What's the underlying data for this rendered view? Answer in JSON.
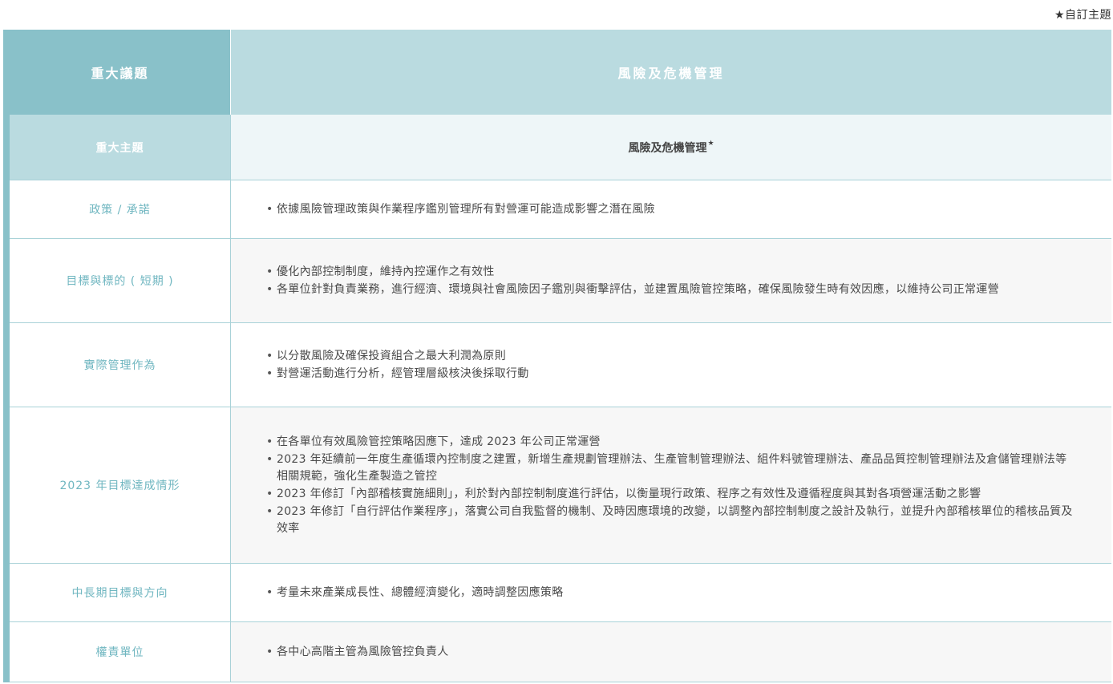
{
  "note": "★自訂主題",
  "header": {
    "left": "重大議題",
    "right": "風險及危機管理"
  },
  "subheader": {
    "left": "重大主題",
    "right": "風險及危機管理",
    "star": "★"
  },
  "rows": [
    {
      "label": "政策 / 承諾",
      "items": [
        "依據風險管理政策與作業程序鑑別管理所有對營運可能造成影響之潛在風險"
      ]
    },
    {
      "label": "目標與標的 ( 短期 )",
      "items": [
        "優化內部控制制度，維持內控運作之有效性",
        "各單位針對負責業務，進行經濟、環境與社會風險因子鑑別與衝擊評估，並建置風險管控策略，確保風險發生時有效因應，以維持公司正常運營"
      ]
    },
    {
      "label": "實際管理作為",
      "items": [
        "以分散風險及確保投資組合之最大利潤為原則",
        "對營運活動進行分析，經管理層級核決後採取行動"
      ]
    },
    {
      "label": "2023 年目標達成情形",
      "items": [
        "在各單位有效風險管控策略因應下，達成 2023 年公司正常運營",
        "2023 年延續前一年度生產循環內控制度之建置，新增生產規劃管理辦法、生產管制管理辦法、組件料號管理辦法、產品品質控制管理辦法及倉儲管理辦法等相關規範，強化生產製造之管控",
        "2023 年修訂「內部稽核實施細則」，利於對內部控制制度進行評估，以衡量現行政策、程序之有效性及遵循程度與其對各項營運活動之影響",
        "2023 年修訂「自行評估作業程序」，落實公司自我監督的機制、及時因應環境的改變，以調整內部控制制度之設計及執行，並提升內部稽核單位的稽核品質及效率"
      ]
    },
    {
      "label": "中長期目標與方向",
      "items": [
        "考量未來產業成長性、總體經濟變化，適時調整因應策略"
      ]
    },
    {
      "label": "權責單位",
      "items": [
        "各中心高階主管為風險管控負責人"
      ]
    }
  ]
}
